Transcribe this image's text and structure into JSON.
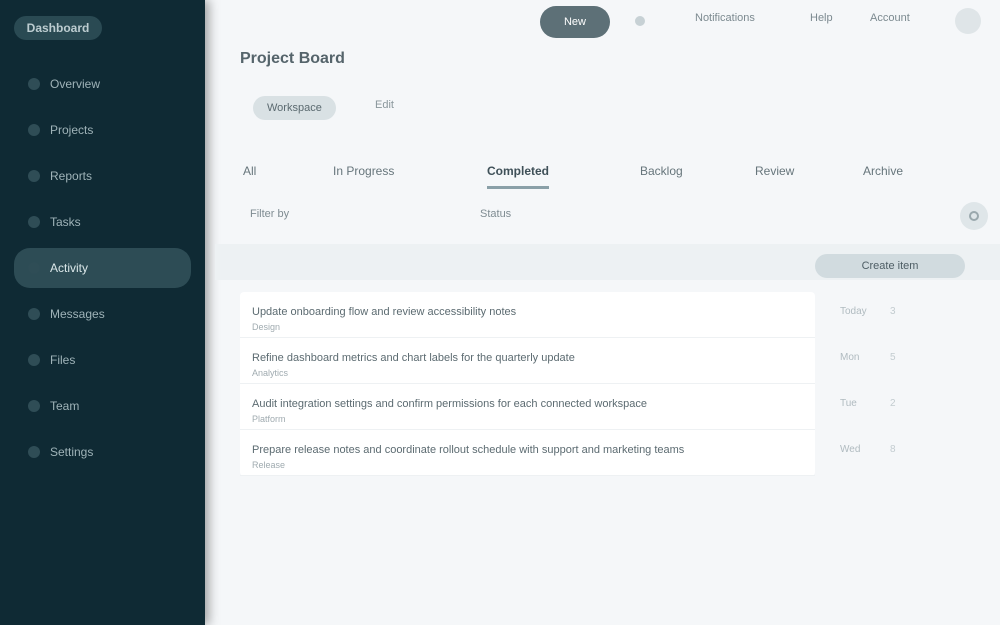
{
  "app": {
    "brand": "Dashboard"
  },
  "sidebar": {
    "items": [
      {
        "label": "Overview"
      },
      {
        "label": "Projects"
      },
      {
        "label": "Reports"
      },
      {
        "label": "Tasks"
      },
      {
        "label": "Activity"
      },
      {
        "label": "Messages"
      },
      {
        "label": "Files"
      },
      {
        "label": "Team"
      },
      {
        "label": "Settings"
      }
    ]
  },
  "topbar": {
    "pill": "New",
    "link_a": "Notifications",
    "link_b": "Help",
    "link_c": "Account"
  },
  "page": {
    "title": "Project Board",
    "chip": "Workspace",
    "link": "Edit"
  },
  "tabs": [
    "All",
    "In Progress",
    "Completed",
    "Backlog",
    "Review",
    "Archive"
  ],
  "filters": {
    "label": "Filter by",
    "value": "Status"
  },
  "actions": {
    "primary": "Create item"
  },
  "rows": [
    {
      "text": "Update onboarding flow and review accessibility notes",
      "sub": "Design",
      "meta_a": "Today",
      "meta_b": "3"
    },
    {
      "text": "Refine dashboard metrics and chart labels for the quarterly update",
      "sub": "Analytics",
      "meta_a": "Mon",
      "meta_b": "5"
    },
    {
      "text": "Audit integration settings and confirm permissions for each connected workspace",
      "sub": "Platform",
      "meta_a": "Tue",
      "meta_b": "2"
    },
    {
      "text": "Prepare release notes and coordinate rollout schedule with support and marketing teams",
      "sub": "Release",
      "meta_a": "Wed",
      "meta_b": "8"
    }
  ],
  "colors": {
    "sidebar": "#0f2a34",
    "accent": "#5d7077",
    "background": "#f5f7f9"
  }
}
